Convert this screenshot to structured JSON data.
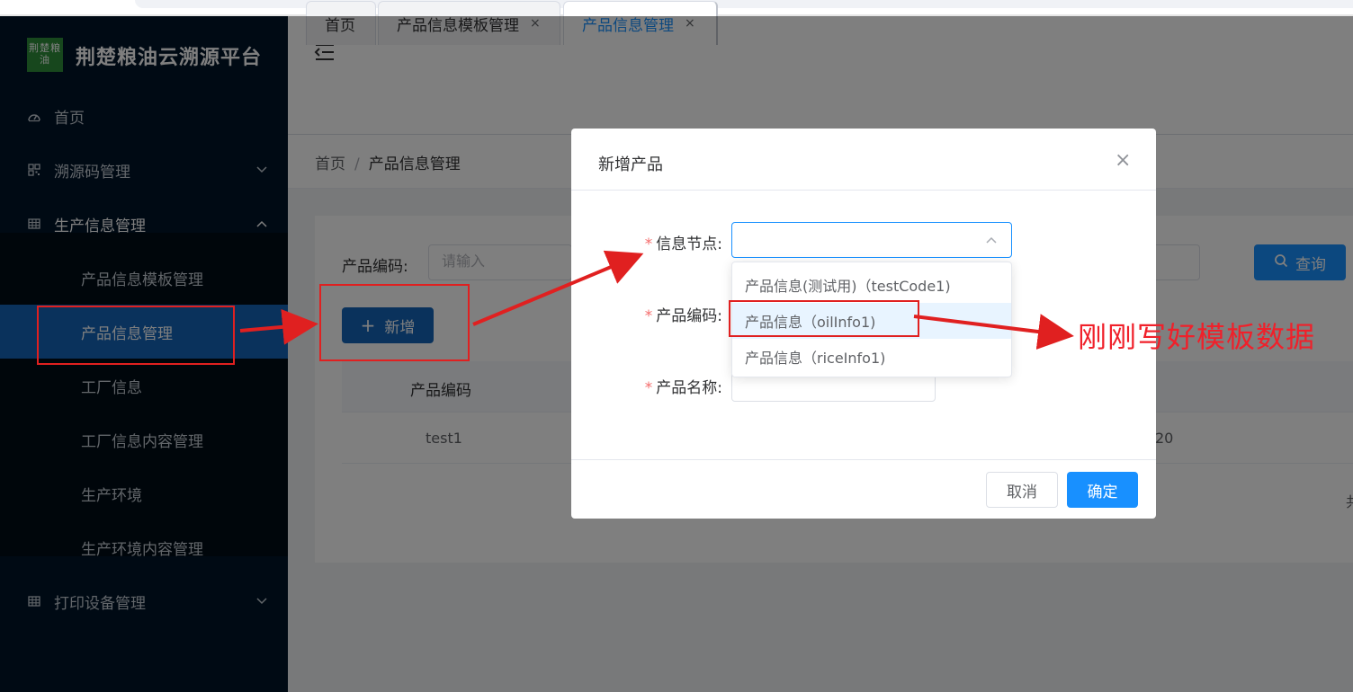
{
  "sidebar": {
    "logo_text": "荆楚粮油",
    "brand_title": "荆楚粮油云溯源平台",
    "items": [
      {
        "label": "首页",
        "icon": "dashboard-icon"
      },
      {
        "label": "溯源码管理",
        "icon": "qrcode-icon",
        "arrow": "⌄"
      },
      {
        "label": "生产信息管理",
        "icon": "table-icon",
        "arrow": "⌃"
      },
      {
        "label": "打印设备管理",
        "icon": "table-icon",
        "arrow": "⌄"
      }
    ],
    "subitems": [
      {
        "label": "产品信息模板管理"
      },
      {
        "label": "产品信息管理",
        "active": true
      },
      {
        "label": "工厂信息"
      },
      {
        "label": "工厂信息内容管理"
      },
      {
        "label": "生产环境"
      },
      {
        "label": "生产环境内容管理"
      }
    ]
  },
  "tabs": [
    {
      "label": "首页"
    },
    {
      "label": "产品信息模板管理",
      "close": "×"
    },
    {
      "label": "产品信息管理",
      "close": "×",
      "active": true
    }
  ],
  "breadcrumb": {
    "home": "首页",
    "sep": "/",
    "current": "产品信息管理"
  },
  "search": {
    "label": "产品编码:",
    "placeholder": "请输入",
    "query_label": "查询"
  },
  "toolbar": {
    "add_label": "新增",
    "add_icon": "+"
  },
  "table": {
    "headers": [
      "产品编码"
    ],
    "rows": [
      {
        "code": "test1",
        "partial": "20"
      }
    ]
  },
  "pager": {
    "partial_text": "共"
  },
  "dialog": {
    "title": "新增产品",
    "close": "×",
    "fields": [
      {
        "label": "信息节点:",
        "required": "*"
      },
      {
        "label": "产品编码:",
        "required": "*"
      },
      {
        "label": "产品名称:",
        "required": "*"
      }
    ],
    "cancel_label": "取消",
    "confirm_label": "确定"
  },
  "dropdown": {
    "options": [
      {
        "label": "产品信息(测试用)（testCode1)"
      },
      {
        "label": "产品信息（oilInfo1)",
        "hover": true
      },
      {
        "label": "产品信息（riceInfo1)"
      }
    ]
  },
  "annotation": {
    "text": "刚刚写好模板数据",
    "color": "#f0202a"
  },
  "colors": {
    "primary": "#1890ff",
    "sidebar_bg": "#001529",
    "active_menu": "#1465b8",
    "annotation_red": "#e02020"
  }
}
